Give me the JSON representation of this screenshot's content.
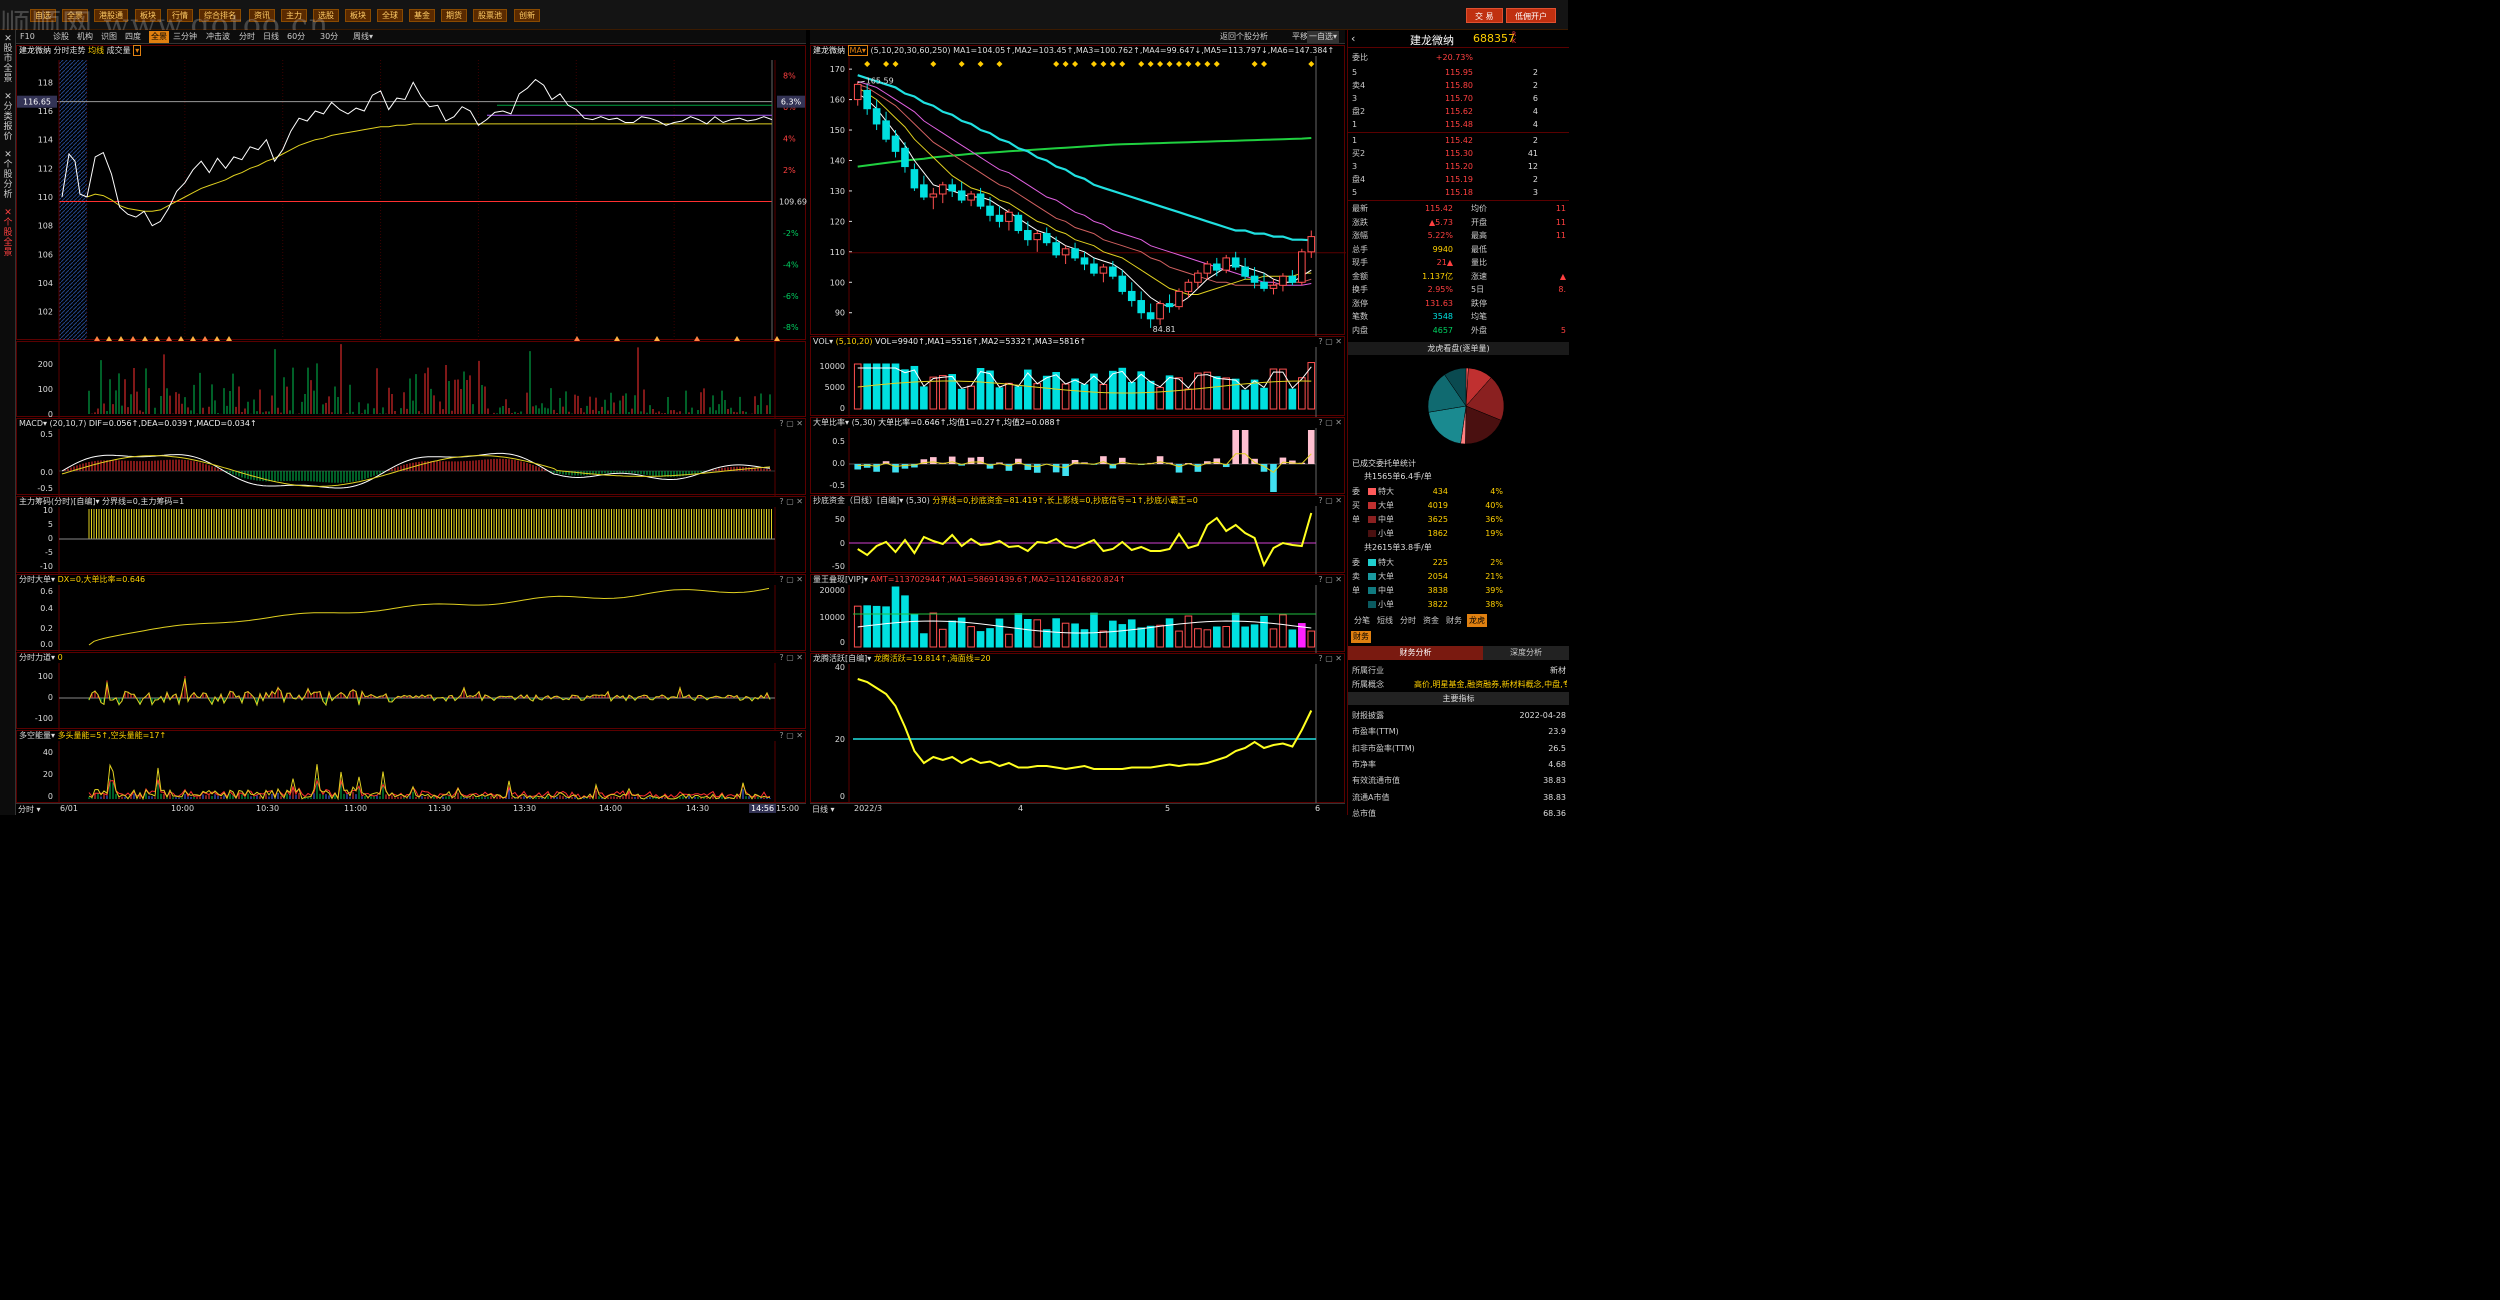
{
  "menubar": {
    "watermark": "顺顺网 www.gotoo.cn",
    "items": [
      "自选",
      "全景",
      "港股通",
      "板块",
      "行情",
      "综合排名",
      "资讯",
      "主力",
      "选股",
      "板块",
      "全球",
      "基金",
      "期货",
      "股票池",
      "创新"
    ],
    "trade_label": "交 易",
    "account_label": "低佣开户"
  },
  "sidetabs": [
    "股市全景",
    "分类报价",
    "个股分析",
    "个股全景"
  ],
  "toolbar": {
    "items": [
      "F10",
      "诊股",
      "机构",
      "识图",
      "四度",
      "全景",
      "三分钟",
      "冲击波",
      "分时",
      "日线",
      "60分",
      "30分",
      "周线▾"
    ],
    "active": "全景"
  },
  "toolbar2": {
    "items": [
      "返回个股分析",
      "平移",
      "一自选▾"
    ]
  },
  "stock": {
    "name": "建龙微纳",
    "code": "688357",
    "rk": "R K"
  },
  "intraday": {
    "title": "建龙微纳",
    "title_items": [
      "分时走势",
      "均线",
      "成交量"
    ],
    "price_ticks": [
      "118",
      "116",
      "114",
      "112",
      "110",
      "108",
      "106",
      "104",
      "102"
    ],
    "pct_ticks": [
      "8%",
      "6%",
      "4%",
      "2%",
      "-2%",
      "-4%",
      "-6%",
      "-8%"
    ],
    "current_price_tag": "116.65",
    "current_pct_tag": "6.3%",
    "prev_close_label": "109.69",
    "vol_ticks": [
      "200",
      "100",
      "0"
    ],
    "price_series": [
      110,
      112.8,
      113.1,
      111.6,
      109.3,
      108.8,
      108.6,
      109,
      108,
      108.3,
      109.2,
      110.4,
      111,
      111.9,
      112.5,
      111.7,
      112.7,
      112,
      112.8,
      112.6,
      113.5,
      113.3,
      114,
      112.5,
      113.3,
      114.6,
      115.5,
      115.3,
      116,
      115.8,
      116.6,
      116.1,
      115.8,
      116.2,
      116,
      117.1,
      117.4,
      116.1,
      116.9,
      116.8,
      118,
      117,
      116.3,
      116.4,
      115.3,
      115.6,
      116.3,
      116,
      115,
      115.4,
      115.9,
      116,
      115.8,
      117.2,
      117.6,
      118.2,
      117.8,
      116.8,
      117.2,
      116.4,
      116.1,
      115.5,
      115.4,
      115.6,
      115.4,
      115.5,
      115.2,
      115.2,
      115.6,
      115.5,
      115.3,
      115,
      115.2,
      115.3,
      115.6,
      115.4,
      115.1,
      115.6,
      115.2,
      115.4,
      115.5,
      115.3,
      115.4,
      115.6,
      115.4
    ],
    "avg_series": [
      110,
      110.2,
      110.1,
      109.8,
      109.4,
      109.2,
      109.1,
      109,
      109,
      109.1,
      109.4,
      109.7,
      110,
      110.3,
      110.6,
      110.8,
      111,
      111.2,
      111.5,
      111.7,
      112,
      112.2,
      112.5,
      112.7,
      113,
      113.3,
      113.6,
      113.8,
      114,
      114.1,
      114.3,
      114.4,
      114.5,
      114.6,
      114.7,
      114.8,
      114.9,
      114.9,
      115,
      115,
      115.1,
      115.1,
      115.1,
      115.1,
      115.1,
      115.1,
      115.1,
      115.1,
      115.1,
      115.1,
      115.1,
      115.1,
      115.1,
      115.1,
      115.1,
      115.1,
      115.1,
      115.1,
      115.1,
      115.1,
      115.1,
      115.1,
      115.1,
      115.1,
      115.1,
      115.1,
      115.1,
      115.1,
      115.1,
      115.1,
      115.1,
      115.1,
      115.1,
      115.1,
      115.1,
      115.1,
      115.1,
      115.1,
      115.1,
      115.1,
      115.1,
      115.1,
      115.1,
      115.1,
      115.1
    ],
    "time_labels": [
      "6/01",
      "10:00",
      "10:30",
      "11:00",
      "11:30",
      "13:30",
      "14:00",
      "14:30",
      "14:56",
      "15:00"
    ]
  },
  "sub_left": {
    "macd": {
      "title": "MACD▾",
      "params": "(20,10,7)",
      "vals": "DIF=0.056↑,DEA=0.039↑,MACD=0.034↑",
      "ticks": [
        "0.5",
        "0.0",
        "-0.5"
      ]
    },
    "zlcm": {
      "title": "主力筹码(分时)[自编]▾",
      "vals": "分界线=0,主力筹码=1",
      "ticks": [
        "10",
        "5",
        "0",
        "-5",
        "-10"
      ]
    },
    "fsdd": {
      "title": "分时大单▾",
      "vals": "DX=0,大单比率=0.646",
      "ticks": [
        "0.6",
        "0.4",
        "0.2",
        "0.0"
      ]
    },
    "fsld": {
      "title": "分时力道▾",
      "vals": "0",
      "ticks": [
        "100",
        "0",
        "-100"
      ]
    },
    "dknl": {
      "title": "多空能量▾",
      "vals": "多头量能=5↑,空头量能=17↑",
      "ticks": [
        "40",
        "20",
        "0"
      ]
    }
  },
  "daily": {
    "title": "建龙微纳",
    "ma_btn": "MA▾",
    "ma_text": "(5,10,20,30,60,250)  MA1=104.05↑,MA2=103.45↑,MA3=100.762↑,MA4=99.647↓,MA5=113.797↓,MA6=147.384↑",
    "price_ticks": [
      "170",
      "160",
      "150",
      "140",
      "130",
      "120",
      "110",
      "100",
      "90"
    ],
    "high_label": "165.59",
    "low_label": "84.81",
    "candles": [
      [
        160,
        166,
        158,
        165
      ],
      [
        163,
        165,
        155,
        157
      ],
      [
        157,
        160,
        150,
        152
      ],
      [
        153,
        156,
        146,
        147
      ],
      [
        148,
        150,
        141,
        143
      ],
      [
        144,
        146,
        136,
        138
      ],
      [
        137,
        139,
        130,
        131
      ],
      [
        132,
        135,
        127,
        128
      ],
      [
        128,
        131,
        124,
        129
      ],
      [
        129,
        133,
        126,
        132
      ],
      [
        132,
        134,
        128,
        130
      ],
      [
        130,
        133,
        126,
        127
      ],
      [
        127,
        130,
        125,
        129
      ],
      [
        129,
        131,
        124,
        125
      ],
      [
        125,
        128,
        120,
        122
      ],
      [
        122,
        125,
        118,
        120
      ],
      [
        120,
        124,
        117,
        123
      ],
      [
        122,
        123,
        116,
        117
      ],
      [
        117,
        120,
        112,
        114
      ],
      [
        114,
        117,
        110,
        116
      ],
      [
        116,
        118,
        112,
        113
      ],
      [
        113,
        115,
        108,
        109
      ],
      [
        109,
        112,
        106,
        111
      ],
      [
        111,
        113,
        107,
        108
      ],
      [
        108,
        110,
        104,
        106
      ],
      [
        106,
        108,
        102,
        103
      ],
      [
        103,
        106,
        100,
        105
      ],
      [
        105,
        107,
        101,
        102
      ],
      [
        102,
        104,
        96,
        97
      ],
      [
        97,
        100,
        92,
        94
      ],
      [
        94,
        97,
        88,
        90
      ],
      [
        90,
        93,
        85,
        88
      ],
      [
        88,
        94,
        86,
        93
      ],
      [
        93,
        96,
        90,
        92
      ],
      [
        92,
        98,
        91,
        97
      ],
      [
        97,
        101,
        95,
        100
      ],
      [
        100,
        104,
        98,
        103
      ],
      [
        103,
        107,
        101,
        106
      ],
      [
        106,
        108,
        102,
        104
      ],
      [
        104,
        109,
        103,
        108
      ],
      [
        108,
        110,
        104,
        105
      ],
      [
        105,
        108,
        101,
        102
      ],
      [
        102,
        105,
        98,
        100
      ],
      [
        100,
        103,
        97,
        98
      ],
      [
        98,
        101,
        96,
        99
      ],
      [
        99,
        103,
        97,
        102
      ],
      [
        102,
        104,
        99,
        100
      ],
      [
        100,
        111,
        99,
        110
      ],
      [
        110,
        117,
        108,
        115
      ]
    ],
    "ma5": [
      162,
      160,
      157,
      153,
      149,
      145,
      140,
      136,
      132,
      131,
      130,
      129,
      128,
      128,
      127,
      125,
      123,
      121,
      119,
      117,
      116,
      114,
      112,
      111,
      110,
      108,
      107,
      106,
      104,
      101,
      98,
      95,
      93,
      92,
      93,
      95,
      98,
      101,
      103,
      105,
      106,
      105,
      104,
      103,
      101,
      100,
      100,
      102,
      104
    ],
    "ma10": [
      164,
      162,
      160,
      157,
      154,
      151,
      147,
      144,
      141,
      138,
      135,
      133,
      131,
      130,
      129,
      127,
      126,
      124,
      122,
      120,
      119,
      117,
      116,
      114,
      113,
      112,
      110,
      109,
      108,
      106,
      104,
      102,
      100,
      98,
      97,
      96,
      96,
      97,
      98,
      99,
      100,
      101,
      101,
      102,
      102,
      102,
      102,
      103,
      103
    ],
    "ma20": [
      165,
      164,
      162,
      160,
      158,
      155,
      152,
      149,
      146,
      144,
      142,
      140,
      138,
      136,
      134,
      132,
      131,
      129,
      127,
      125,
      123,
      121,
      120,
      118,
      117,
      116,
      114,
      113,
      112,
      111,
      110,
      108,
      107,
      105,
      104,
      103,
      102,
      101,
      100,
      100,
      99,
      99,
      99,
      99,
      99,
      100,
      100,
      100,
      101
    ],
    "ma30": [
      166,
      165,
      164,
      162,
      160,
      158,
      156,
      153,
      151,
      149,
      147,
      145,
      143,
      141,
      139,
      137,
      136,
      134,
      132,
      130,
      128,
      127,
      125,
      123,
      122,
      120,
      119,
      117,
      116,
      115,
      114,
      112,
      111,
      110,
      109,
      108,
      107,
      106,
      105,
      104,
      103,
      102,
      101,
      100,
      100,
      99,
      99,
      99,
      99.6
    ],
    "ma60": [
      168,
      167,
      166,
      165,
      164,
      162,
      161,
      159,
      158,
      156,
      155,
      153,
      152,
      150,
      149,
      147,
      146,
      144,
      143,
      141,
      140,
      138,
      137,
      135,
      134,
      132,
      131,
      130,
      129,
      128,
      127,
      126,
      125,
      124,
      123,
      122,
      121,
      120,
      119,
      118,
      117,
      117,
      116,
      116,
      115,
      115,
      114,
      114,
      113.8
    ],
    "ma250": [
      138,
      138.4,
      138.8,
      139.2,
      139.6,
      140,
      140.3,
      140.6,
      141,
      141.3,
      141.6,
      141.9,
      142.2,
      142.4,
      142.6,
      142.8,
      143,
      143.2,
      143.4,
      143.6,
      143.8,
      144,
      144.2,
      144.4,
      144.6,
      144.8,
      145,
      145.2,
      145.3,
      145.4,
      145.5,
      145.6,
      145.7,
      145.8,
      145.9,
      146,
      146.1,
      146.2,
      146.3,
      146.4,
      146.5,
      146.6,
      146.7,
      146.8,
      146.9,
      147,
      147.1,
      147.2,
      147.4
    ],
    "x_labels": [
      "2022/3",
      "4",
      "5",
      "6"
    ]
  },
  "sub_right": {
    "vol": {
      "title": "VOL▾",
      "params": "(5,10,20)",
      "vals": "VOL=9940↑,MA1=5516↑,MA2=5332↑,MA3=5816↑",
      "ticks": [
        "10000",
        "5000",
        "0"
      ]
    },
    "ddbl": {
      "title": "大单比率▾",
      "params": "(5,30)",
      "vals": "大单比率=0.646↑,均值1=0.27↑,均值2=0.088↑",
      "ticks": [
        "0.5",
        "0.0",
        "-0.5"
      ]
    },
    "cdzj": {
      "title": "抄底资金（日线）[自编]▾",
      "params": "(5,30)",
      "vals": "分界线=0,抄底资金=81.419↑,长上影线=0,抄底信号=1↑,抄底小霸王=0",
      "ticks": [
        "50",
        "0",
        "-50"
      ]
    },
    "lwdx": {
      "title": "量王叠现[VIP]▾",
      "vals": "AMT=113702944↑,MA1=58691439.6↑,MA2=112416820.824↑",
      "ticks": [
        "20000",
        "10000",
        "0"
      ]
    },
    "ltzq": {
      "title": "龙腾活跃[自编]▾",
      "vals": "龙腾活跃=19.814↑,海面线=20",
      "ticks": [
        "40",
        "20",
        "0"
      ]
    }
  },
  "quote": {
    "webi_label": "委比",
    "webi_val": "+20.73%",
    "sell": [
      {
        "lbl": "5",
        "p": "115.95",
        "v": "2"
      },
      {
        "lbl": "卖4",
        "p": "115.80",
        "v": "2"
      },
      {
        "lbl": "3",
        "p": "115.70",
        "v": "6"
      },
      {
        "lbl": "盘2",
        "p": "115.62",
        "v": "4"
      },
      {
        "lbl": "1",
        "p": "115.48",
        "v": "4"
      }
    ],
    "buy": [
      {
        "lbl": "1",
        "p": "115.42",
        "v": "2"
      },
      {
        "lbl": "买2",
        "p": "115.30",
        "v": "41"
      },
      {
        "lbl": "3",
        "p": "115.20",
        "v": "12"
      },
      {
        "lbl": "盘4",
        "p": "115.19",
        "v": "2"
      },
      {
        "lbl": "5",
        "p": "115.18",
        "v": "3"
      }
    ],
    "stats": [
      {
        "l": "最新",
        "v": "115.42",
        "l2": "均价",
        "v2": "11"
      },
      {
        "l": "涨跌",
        "v": "▲5.73",
        "l2": "开盘",
        "v2": "11"
      },
      {
        "l": "涨幅",
        "v": "5.22%",
        "l2": "最高",
        "v2": "11"
      },
      {
        "l": "总手",
        "v": "9940",
        "l2": "最低",
        "v2": ""
      },
      {
        "l": "现手",
        "v": "21▲",
        "l2": "量比",
        "v2": ""
      },
      {
        "l": "金额",
        "v": "1.137亿",
        "l2": "涨速",
        "v2": "▲"
      },
      {
        "l": "换手",
        "v": "2.95%",
        "l2": "5日",
        "v2": "8."
      },
      {
        "l": "涨停",
        "v": "131.63",
        "l2": "跌停",
        "v2": ""
      },
      {
        "l": "笔数",
        "v": "3548",
        "l2": "均笔",
        "v2": ""
      },
      {
        "l": "内盘",
        "v": "4657",
        "l2": "外盘",
        "v2": "5"
      }
    ],
    "pie_title": "龙虎看盘(逐单量)",
    "pie": [
      {
        "v": 2,
        "c": "#ff5a5a"
      },
      {
        "v": 21,
        "c": "#c03030"
      },
      {
        "v": 39,
        "c": "#8a2020"
      },
      {
        "v": 38,
        "c": "#4a1010"
      },
      {
        "v": 4,
        "c": "#ff8080"
      },
      {
        "v": 40,
        "c": "#1a8a90"
      },
      {
        "v": 36,
        "c": "#106a70"
      },
      {
        "v": 19,
        "c": "#0a4a50"
      }
    ],
    "deleg_title": "已成交委托单统计",
    "buy_summary": "共1565单6.4手/单",
    "buy_rows": [
      {
        "side": "委",
        "name": "特大",
        "n": "434",
        "p": "4%",
        "c": "#ff5a5a"
      },
      {
        "side": "买",
        "name": "大单",
        "n": "4019",
        "p": "40%",
        "c": "#c03030"
      },
      {
        "side": "单",
        "name": "中单",
        "n": "3625",
        "p": "36%",
        "c": "#8a2020"
      },
      {
        "side": "",
        "name": "小单",
        "n": "1862",
        "p": "19%",
        "c": "#4a1010"
      }
    ],
    "sell_summary": "共2615单3.8手/单",
    "sell_rows": [
      {
        "side": "委",
        "name": "特大",
        "n": "225",
        "p": "2%",
        "c": "#20d0d0"
      },
      {
        "side": "卖",
        "name": "大单",
        "n": "2054",
        "p": "21%",
        "c": "#1a9aa0"
      },
      {
        "side": "单",
        "name": "中单",
        "n": "3838",
        "p": "39%",
        "c": "#107a80"
      },
      {
        "side": "",
        "name": "小单",
        "n": "3822",
        "p": "38%",
        "c": "#0a5a60"
      }
    ],
    "tabs": [
      "分笔",
      "短线",
      "分时",
      "资金",
      "财务",
      "龙虎"
    ],
    "active_tab": "龙虎",
    "fin_tab": "财务",
    "fin_subtabs": [
      "财务分析",
      "深度分析"
    ],
    "industry_l": "所属行业",
    "industry_v": "新材",
    "concept_l": "所属概念",
    "concept_v": "高价,明星基金,融资融券,新材料概念,中盘,专精",
    "main_index": "主要指标",
    "fin": [
      {
        "l": "财报披露",
        "v": "2022-04-28"
      },
      {
        "l": "市盈率(TTM)",
        "v": "23.9"
      },
      {
        "l": "扣非市盈率(TTM)",
        "v": "26.5"
      },
      {
        "l": "市净率",
        "v": "4.68"
      },
      {
        "l": "有效流通市值",
        "v": "38.83"
      },
      {
        "l": "流通A市值",
        "v": "38.83"
      },
      {
        "l": "总市值",
        "v": "68.36"
      }
    ]
  }
}
